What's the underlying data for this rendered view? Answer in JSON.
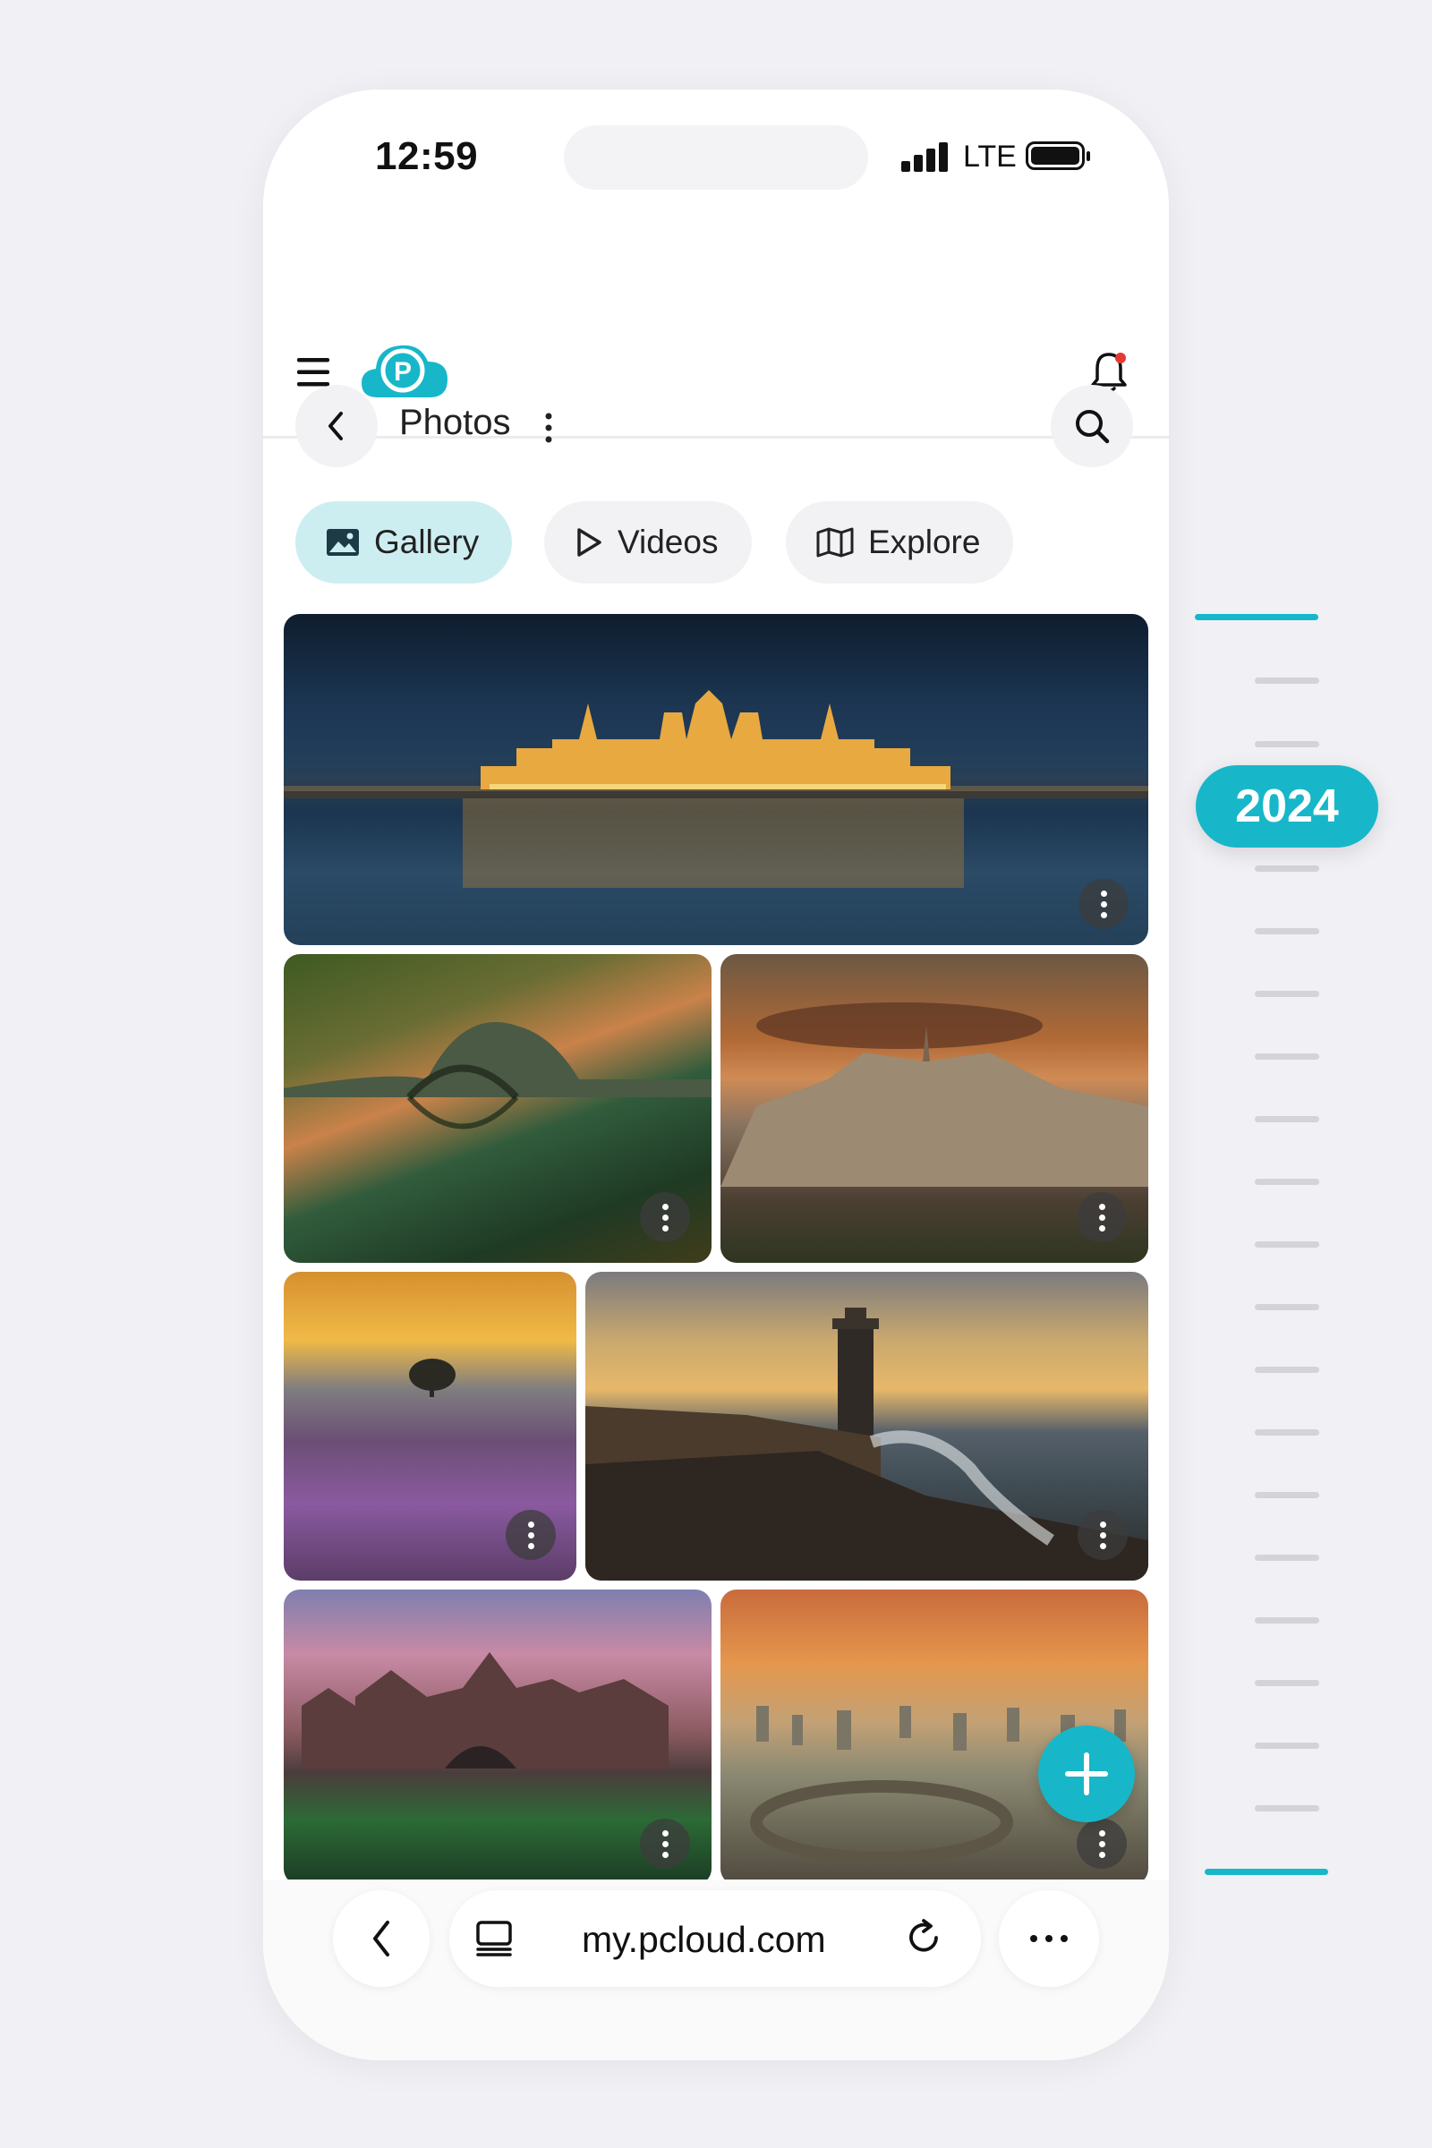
{
  "status_bar": {
    "time": "12:59",
    "network": "LTE"
  },
  "app": {
    "logo_letter": "P",
    "brand_color": "#17b7c9"
  },
  "photos_bar": {
    "title": "Photos"
  },
  "tabs": [
    {
      "label": "Gallery",
      "icon": "image-icon",
      "active": true
    },
    {
      "label": "Videos",
      "icon": "play-icon",
      "active": false
    },
    {
      "label": "Explore",
      "icon": "map-icon",
      "active": false
    }
  ],
  "photos": [
    {
      "subject": "parliament-night",
      "icon": "more-vertical-icon"
    },
    {
      "subject": "stone-bridge-reflection",
      "icon": "more-vertical-icon"
    },
    {
      "subject": "hilltop-town-sunset",
      "icon": "more-vertical-icon"
    },
    {
      "subject": "lavender-field-tree",
      "icon": "more-vertical-icon"
    },
    {
      "subject": "lighthouse-waves",
      "icon": "more-vertical-icon"
    },
    {
      "subject": "castle-moat",
      "icon": "more-vertical-icon"
    },
    {
      "subject": "stone-pillars-desert",
      "icon": "more-vertical-icon"
    }
  ],
  "browser": {
    "url": "my.pcloud.com"
  },
  "timeline": {
    "year": "2024"
  }
}
